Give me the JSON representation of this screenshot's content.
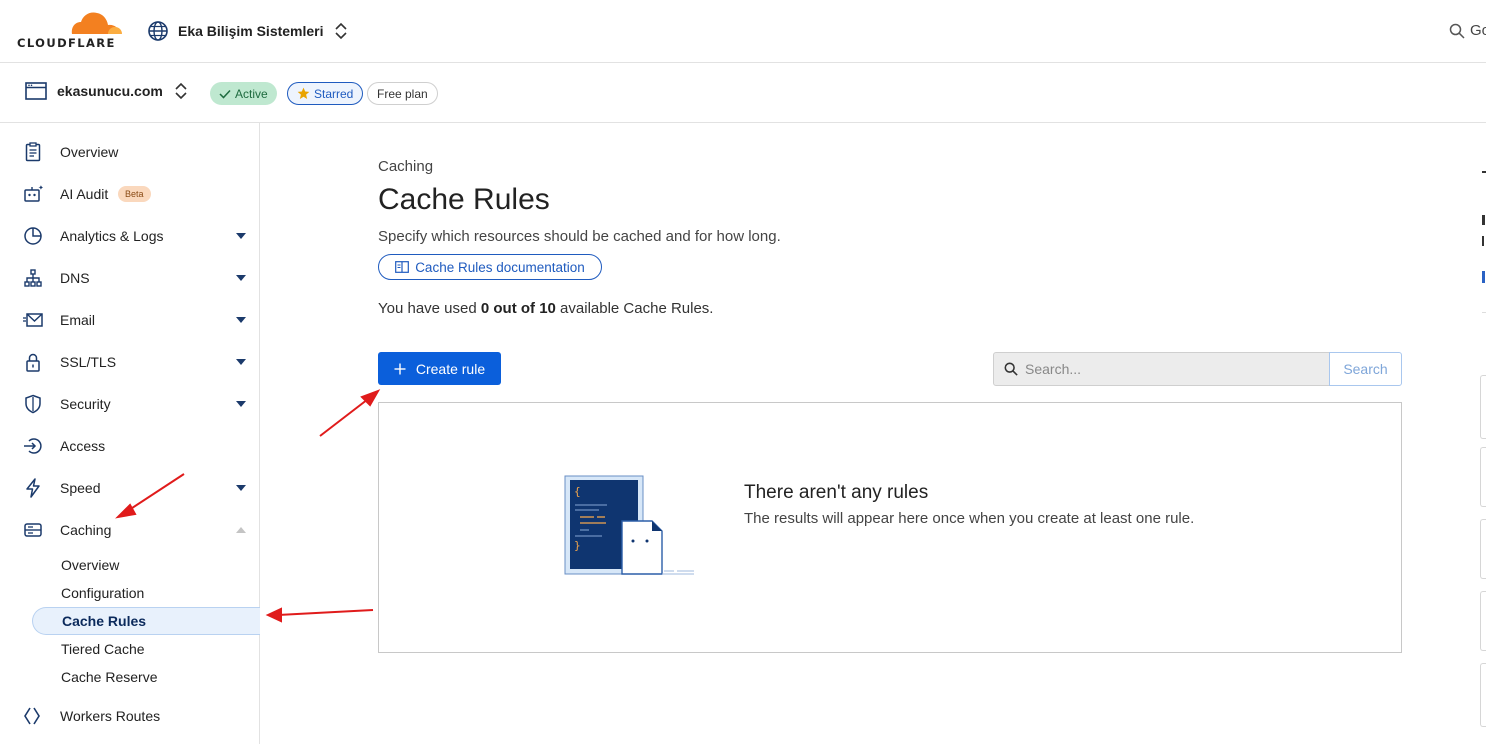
{
  "header": {
    "logo_text": "CLOUDFLARE",
    "account_name": "Eka Bilişim Sistemleri",
    "search_label": "Go"
  },
  "zone": {
    "domain": "ekasunucu.com",
    "status": "Active",
    "starred": "Starred",
    "plan": "Free plan"
  },
  "sidebar": {
    "items": [
      {
        "label": "Overview",
        "icon": "clipboard-icon"
      },
      {
        "label": "AI Audit",
        "icon": "robot-icon",
        "badge": "Beta"
      },
      {
        "label": "Analytics & Logs",
        "icon": "pie-chart-icon"
      },
      {
        "label": "DNS",
        "icon": "network-icon"
      },
      {
        "label": "Email",
        "icon": "envelope-icon"
      },
      {
        "label": "SSL/TLS",
        "icon": "lock-icon"
      },
      {
        "label": "Security",
        "icon": "shield-icon"
      },
      {
        "label": "Access",
        "icon": "access-icon"
      },
      {
        "label": "Speed",
        "icon": "lightning-icon"
      },
      {
        "label": "Caching",
        "icon": "server-icon"
      },
      {
        "label": "Workers Routes",
        "icon": "workers-icon"
      }
    ],
    "caching_sub": [
      "Overview",
      "Configuration",
      "Cache Rules",
      "Tiered Cache",
      "Cache Reserve"
    ],
    "selected": "Cache Rules"
  },
  "main": {
    "breadcrumb": "Caching",
    "title": "Cache Rules",
    "subtitle": "Specify which resources should be cached and for how long.",
    "doc_link": "Cache Rules documentation",
    "usage_prefix": "You have used ",
    "usage_count": "0 out of 10",
    "usage_suffix": " available Cache Rules.",
    "create_button": "Create rule",
    "search_placeholder": "Search...",
    "search_button": "Search",
    "empty_title": "There aren't any rules",
    "empty_text": "The results will appear here once when you create at least one rule."
  },
  "colors": {
    "accent": "#0b5fdb",
    "brand_orange": "#f38020",
    "annotation_arrow": "#e01b1b"
  }
}
